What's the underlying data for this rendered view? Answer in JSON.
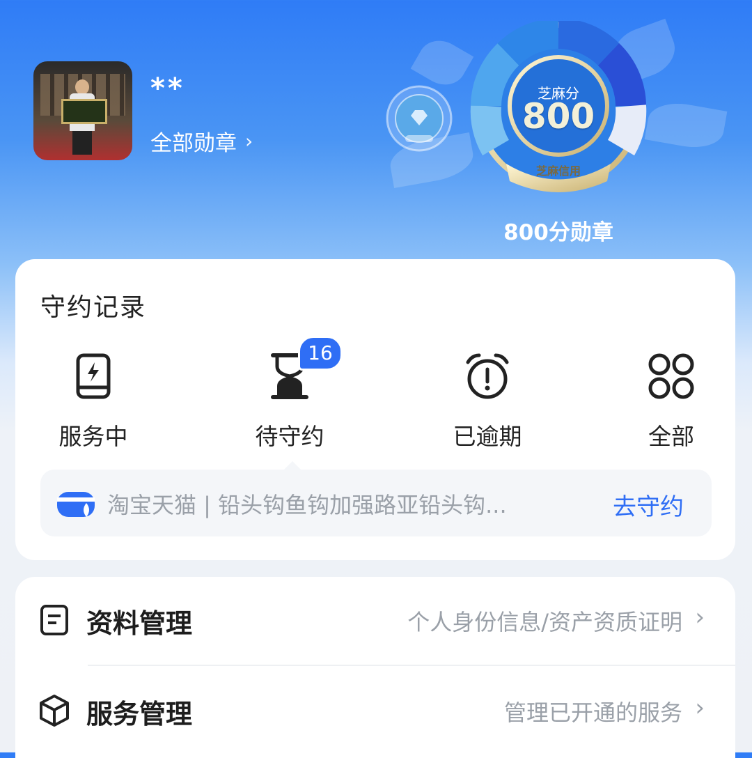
{
  "profile": {
    "username": "**",
    "badges_link": "全部勋章",
    "chevron": "›"
  },
  "credit": {
    "title": "芝麻分",
    "score": "800",
    "brand": "芝麻信用",
    "medal_caption": "800分勋章"
  },
  "records": {
    "title": "守约记录",
    "items": [
      {
        "label": "服务中",
        "icon": "phone-charge-icon"
      },
      {
        "label": "待守约",
        "icon": "hourglass-icon",
        "badge": "16"
      },
      {
        "label": "已逾期",
        "icon": "alarm-clock-icon"
      },
      {
        "label": "全部",
        "icon": "grid-icon"
      }
    ],
    "pending": {
      "text": "淘宝天猫 | 铅头钩鱼钩加强路亚铅头钩...",
      "action": "去守约"
    }
  },
  "menu": [
    {
      "title": "资料管理",
      "desc": "个人身份信息/资产资质证明",
      "icon": "document-icon"
    },
    {
      "title": "服务管理",
      "desc": "管理已开通的服务",
      "icon": "cube-icon"
    }
  ],
  "colors": {
    "accent": "#2f6ef5",
    "hero_top": "#2f7cf6"
  }
}
